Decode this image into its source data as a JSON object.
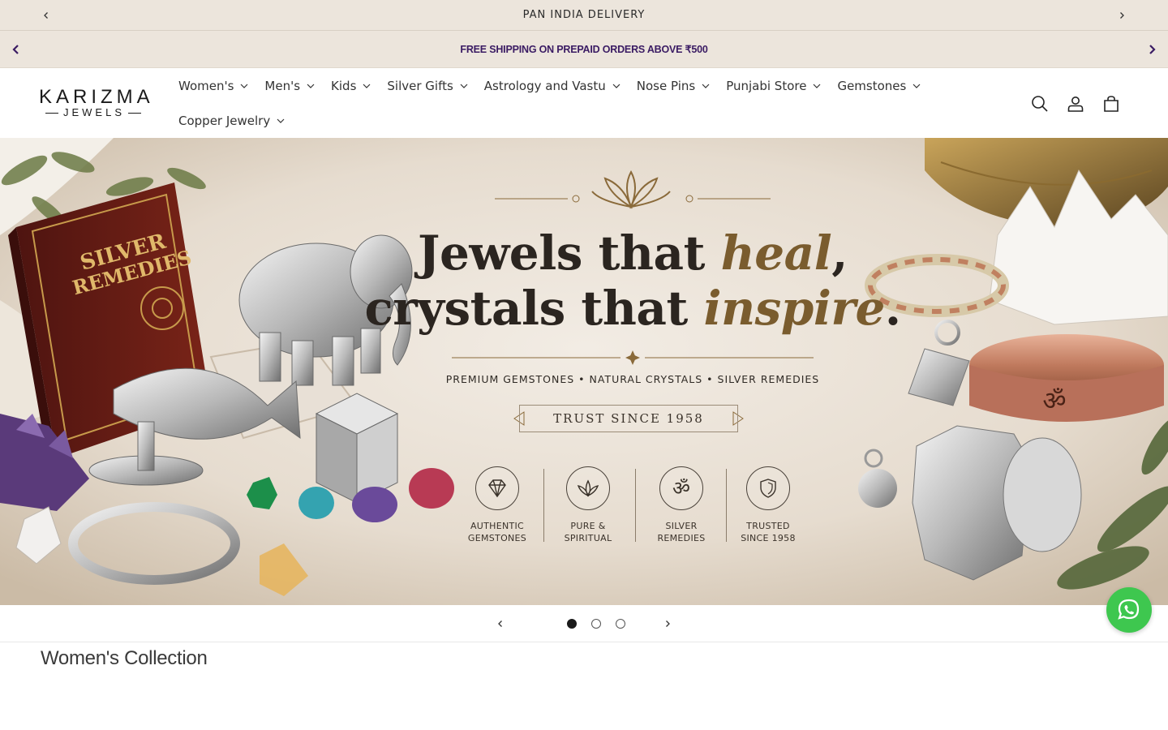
{
  "announcement_top": {
    "text": "PAN INDIA DELIVERY"
  },
  "announcement_second": {
    "text": "FREE SHIPPING ON PREPAID ORDERS ABOVE ₹500"
  },
  "header": {
    "logo": {
      "line1": "KARIZMA",
      "line2": "JEWELS"
    },
    "nav": [
      {
        "label": "Women's"
      },
      {
        "label": "Men's"
      },
      {
        "label": "Kids"
      },
      {
        "label": "Silver Gifts"
      },
      {
        "label": "Astrology and Vastu"
      },
      {
        "label": "Nose Pins"
      },
      {
        "label": "Punjabi Store"
      },
      {
        "label": "Gemstones"
      },
      {
        "label": "Copper Jewelry"
      }
    ],
    "icons": [
      "search-icon",
      "account-icon",
      "cart-icon"
    ]
  },
  "hero": {
    "heading_line1_a": "Jewels that ",
    "heading_line1_b": "heal",
    "heading_line1_c": ",",
    "heading_line2_a": "crystals that ",
    "heading_line2_b": "inspire",
    "heading_line2_c": ".",
    "subline": "PREMIUM GEMSTONES  •  NATURAL CRYSTALS  •  SILVER REMEDIES",
    "trust": "TRUST SINCE 1958",
    "book_title_1": "SILVER",
    "book_title_2": "REMEDIES",
    "bangle_text": "ॐ",
    "features": [
      {
        "line1": "AUTHENTIC",
        "line2": "GEMSTONES",
        "icon": "diamond-icon"
      },
      {
        "line1": "PURE &",
        "line2": "SPIRITUAL",
        "icon": "lotus-icon"
      },
      {
        "line1": "SILVER",
        "line2": "REMEDIES",
        "icon": "om-icon"
      },
      {
        "line1": "TRUSTED",
        "line2": "SINCE 1958",
        "icon": "shield-icon"
      }
    ],
    "feature_om": "ॐ"
  },
  "slider": {
    "slides": 3,
    "active": 1
  },
  "section": {
    "title": "Women's Collection"
  },
  "colors": {
    "announcement_bg": "#ece5dc",
    "promo_text": "#3a1b63",
    "whatsapp": "#3ec74f",
    "hero_gold": "#7a5c2e"
  }
}
